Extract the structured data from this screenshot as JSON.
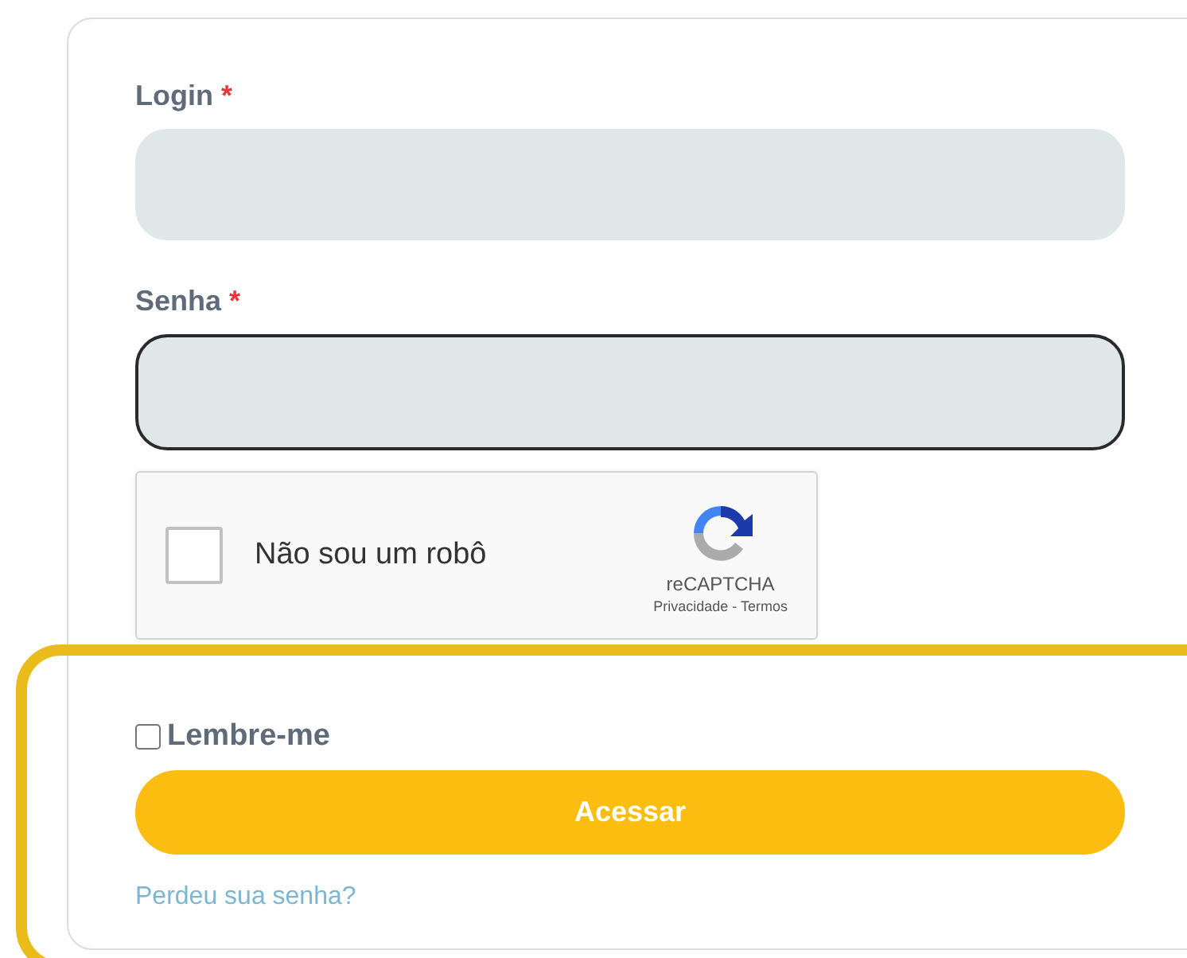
{
  "fields": [
    {
      "label": "Login",
      "required_mark": "*",
      "focused": false
    },
    {
      "label": "Senha",
      "required_mark": "*",
      "focused": true
    }
  ],
  "captcha": {
    "checked": false,
    "label": "Não sou um robô",
    "brand": "reCAPTCHA",
    "links": "Privacidade - Termos"
  },
  "remember": {
    "label": "Lembre-me",
    "checked": false
  },
  "submit_button": "Acessar",
  "forgot_link": "Perdeu sua senha?",
  "highlight": {
    "shown": true,
    "color": "#e9bc1c"
  }
}
